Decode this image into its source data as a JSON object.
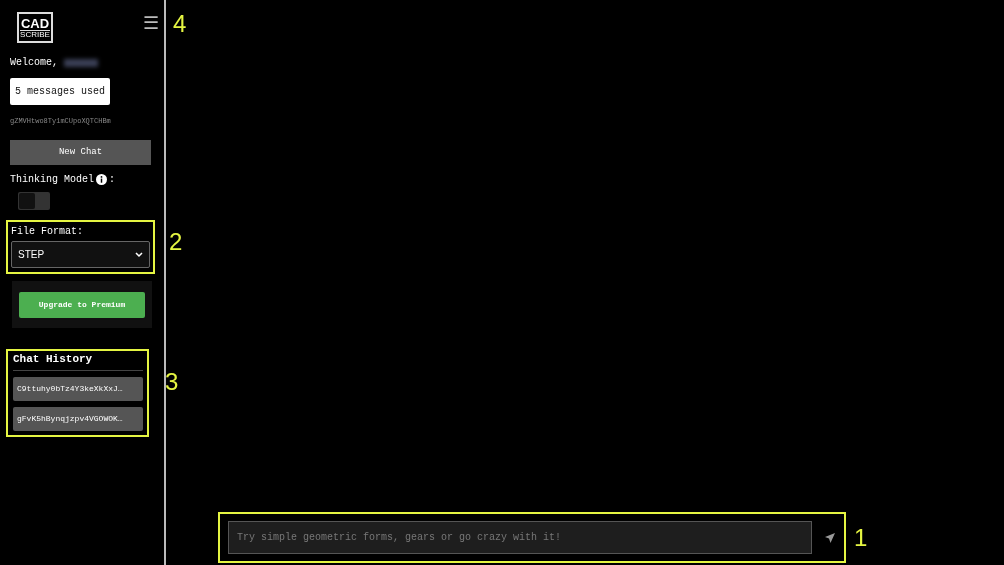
{
  "logo": {
    "top": "CAD",
    "bottom": "SCRIBE"
  },
  "menu_button": {
    "glyph": "☰",
    "annotation": "4"
  },
  "welcome": {
    "text": "Welcome,",
    "name_redacted": true
  },
  "usage": "5 messages used",
  "session_id": "gZMVHtwo8Ty1mCUpoXQTCHBm",
  "new_chat": "New Chat",
  "thinking_model": {
    "label": "Thinking Model",
    "suffix": ":",
    "on": false
  },
  "file_format": {
    "label": "File Format:",
    "value": "STEP",
    "annotation": "2"
  },
  "upgrade": "Upgrade to Premium",
  "chat_history": {
    "title": "Chat History",
    "annotation": "3",
    "items": [
      {
        "label": "C9ttuhy0bTz4Y3keXkXxJ…"
      },
      {
        "label": "gFvK5hBynqjzpv4VGOWOK…"
      }
    ]
  },
  "prompt": {
    "placeholder": "Try simple geometric forms, gears or go crazy with it!",
    "annotation": "1"
  }
}
